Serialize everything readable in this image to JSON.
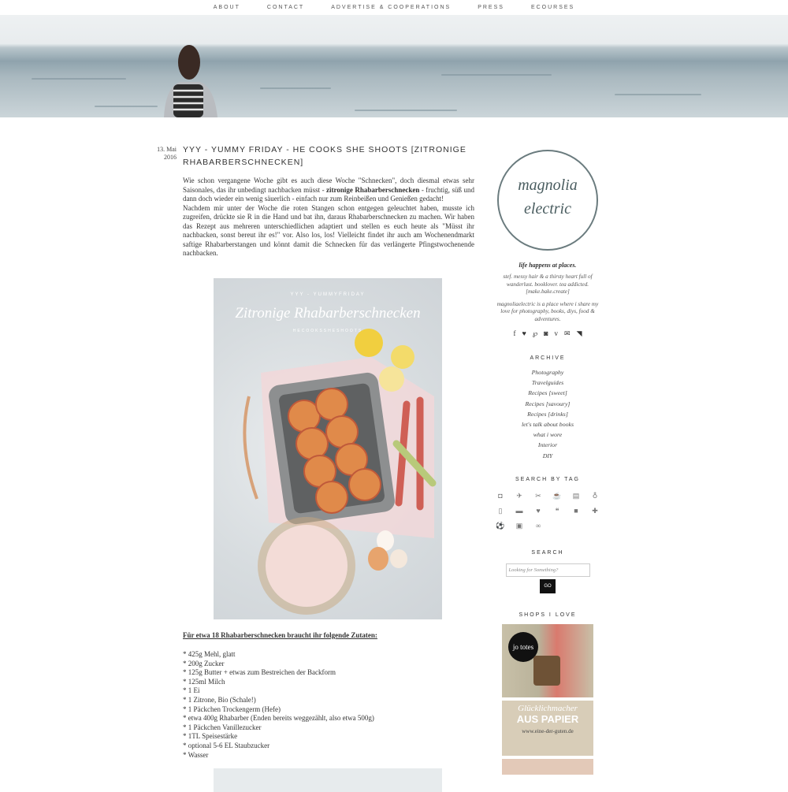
{
  "nav": [
    "ABOUT",
    "CONTACT",
    "ADVERTISE & COOPERATIONS",
    "PRESS",
    "ECOURSES"
  ],
  "post": {
    "date_day": "13. Mai",
    "date_year": "2016",
    "title": "YYY - YUMMY FRIDAY - HE COOKS SHE SHOOTS [ZITRONIGE RHABARBERSCHNECKEN]",
    "p1_a": "Wie schon vergangene Woche gibt es auch diese Woche \"Schnecken\", doch diesmal etwas sehr Saisonales, das ihr unbedingt nachbacken müsst - ",
    "p1_b": "zitronige Rhabarberschnecken",
    "p1_c": " - fruchtig, süß und dann doch wieder ein wenig säuerlich - einfach nur zum Reinbeißen und Genießen gedacht!",
    "p2": "Nachdem mir unter der Woche die roten Stangen schon entgegen geleuchtet haben, musste ich zugreifen, drückte sie R in die Hand und bat ihn, daraus Rhabarberschnecken zu machen. Wir haben das Rezept aus mehreren unterschiedlichen adaptiert und stellen es euch heute als \"Müsst ihr nachbacken, sonst bereut ihr es!\" vor. Also los, los! Vielleicht findet ihr auch am Wochenendmarkt saftige Rhabarberstangen und könnt damit die Schnecken für das verlängerte Pfingstwochenende nachbacken.",
    "photo_kicker": "YYY - YUMMYFRIDAY",
    "photo_title": "Zitronige Rhabarberschnecken",
    "photo_sub": "HECOOKSSHESHOOTS",
    "ingredients_heading": "Für etwa 18 Rhabarberschnecken braucht ihr folgende Zutaten:",
    "ingredients": [
      "* 425g Mehl, glatt",
      "* 200g Zucker",
      "* 125g Butter + etwas zum Bestreichen der Backform",
      "* 125ml Milch",
      "* 1 Ei",
      "* 1 Zitrone, Bio (Schale!)",
      "* 1 Päckchen Trockengerm (Hefe)",
      "* etwa 400g Rhabarber (Enden bereits weggezählt, also etwa 500g)",
      "* 1 Päckchen Vanillezucker",
      "* 1TL Speisestärke",
      "* optional 5-6 EL Staubzucker",
      "* Wasser"
    ]
  },
  "sidebar": {
    "logo_line1": "magnolia",
    "logo_line2": "electric",
    "tagline": "life happens at places.",
    "bio1": "stef. messy hair & a thirsty heart full of wanderlust. booklover. tea addicted. [make.bake.create]",
    "bio2": "magnoliaelectric is a place where i share my love for photography, books, diys, food & adventures.",
    "social_icons": [
      "facebook-icon",
      "heart-icon",
      "pinterest-icon",
      "instagram-icon",
      "vimeo-icon",
      "mail-icon",
      "rss-icon"
    ],
    "archive_heading": "ARCHIVE",
    "archive": [
      "Photography",
      "Travelguides",
      "Recipes [sweet]",
      "Recipes [savoury]",
      "Recipes [drinks]",
      "let's talk about books",
      "what i wore",
      "Interior",
      "DIY"
    ],
    "tags_heading": "SEARCH BY TAG",
    "tag_icons": [
      "camera-icon",
      "plane-icon",
      "scissors-icon",
      "cup-icon",
      "book-icon",
      "pin-icon",
      "phone-icon",
      "bed-icon",
      "heart-icon",
      "quote-icon",
      "video-icon",
      "puzzle-icon",
      "ball-icon",
      "gift-icon",
      "binoculars-icon"
    ],
    "search_heading": "SEARCH",
    "search_placeholder": "Looking for Something?",
    "search_button": "GO",
    "shops_heading": "SHOPS I LOVE",
    "shop1_text": "jo totes",
    "shop2_line1": "Glücklichmacher",
    "shop2_line2": "AUS PAPIER",
    "shop2_url": "www.eine-der-guten.de"
  }
}
